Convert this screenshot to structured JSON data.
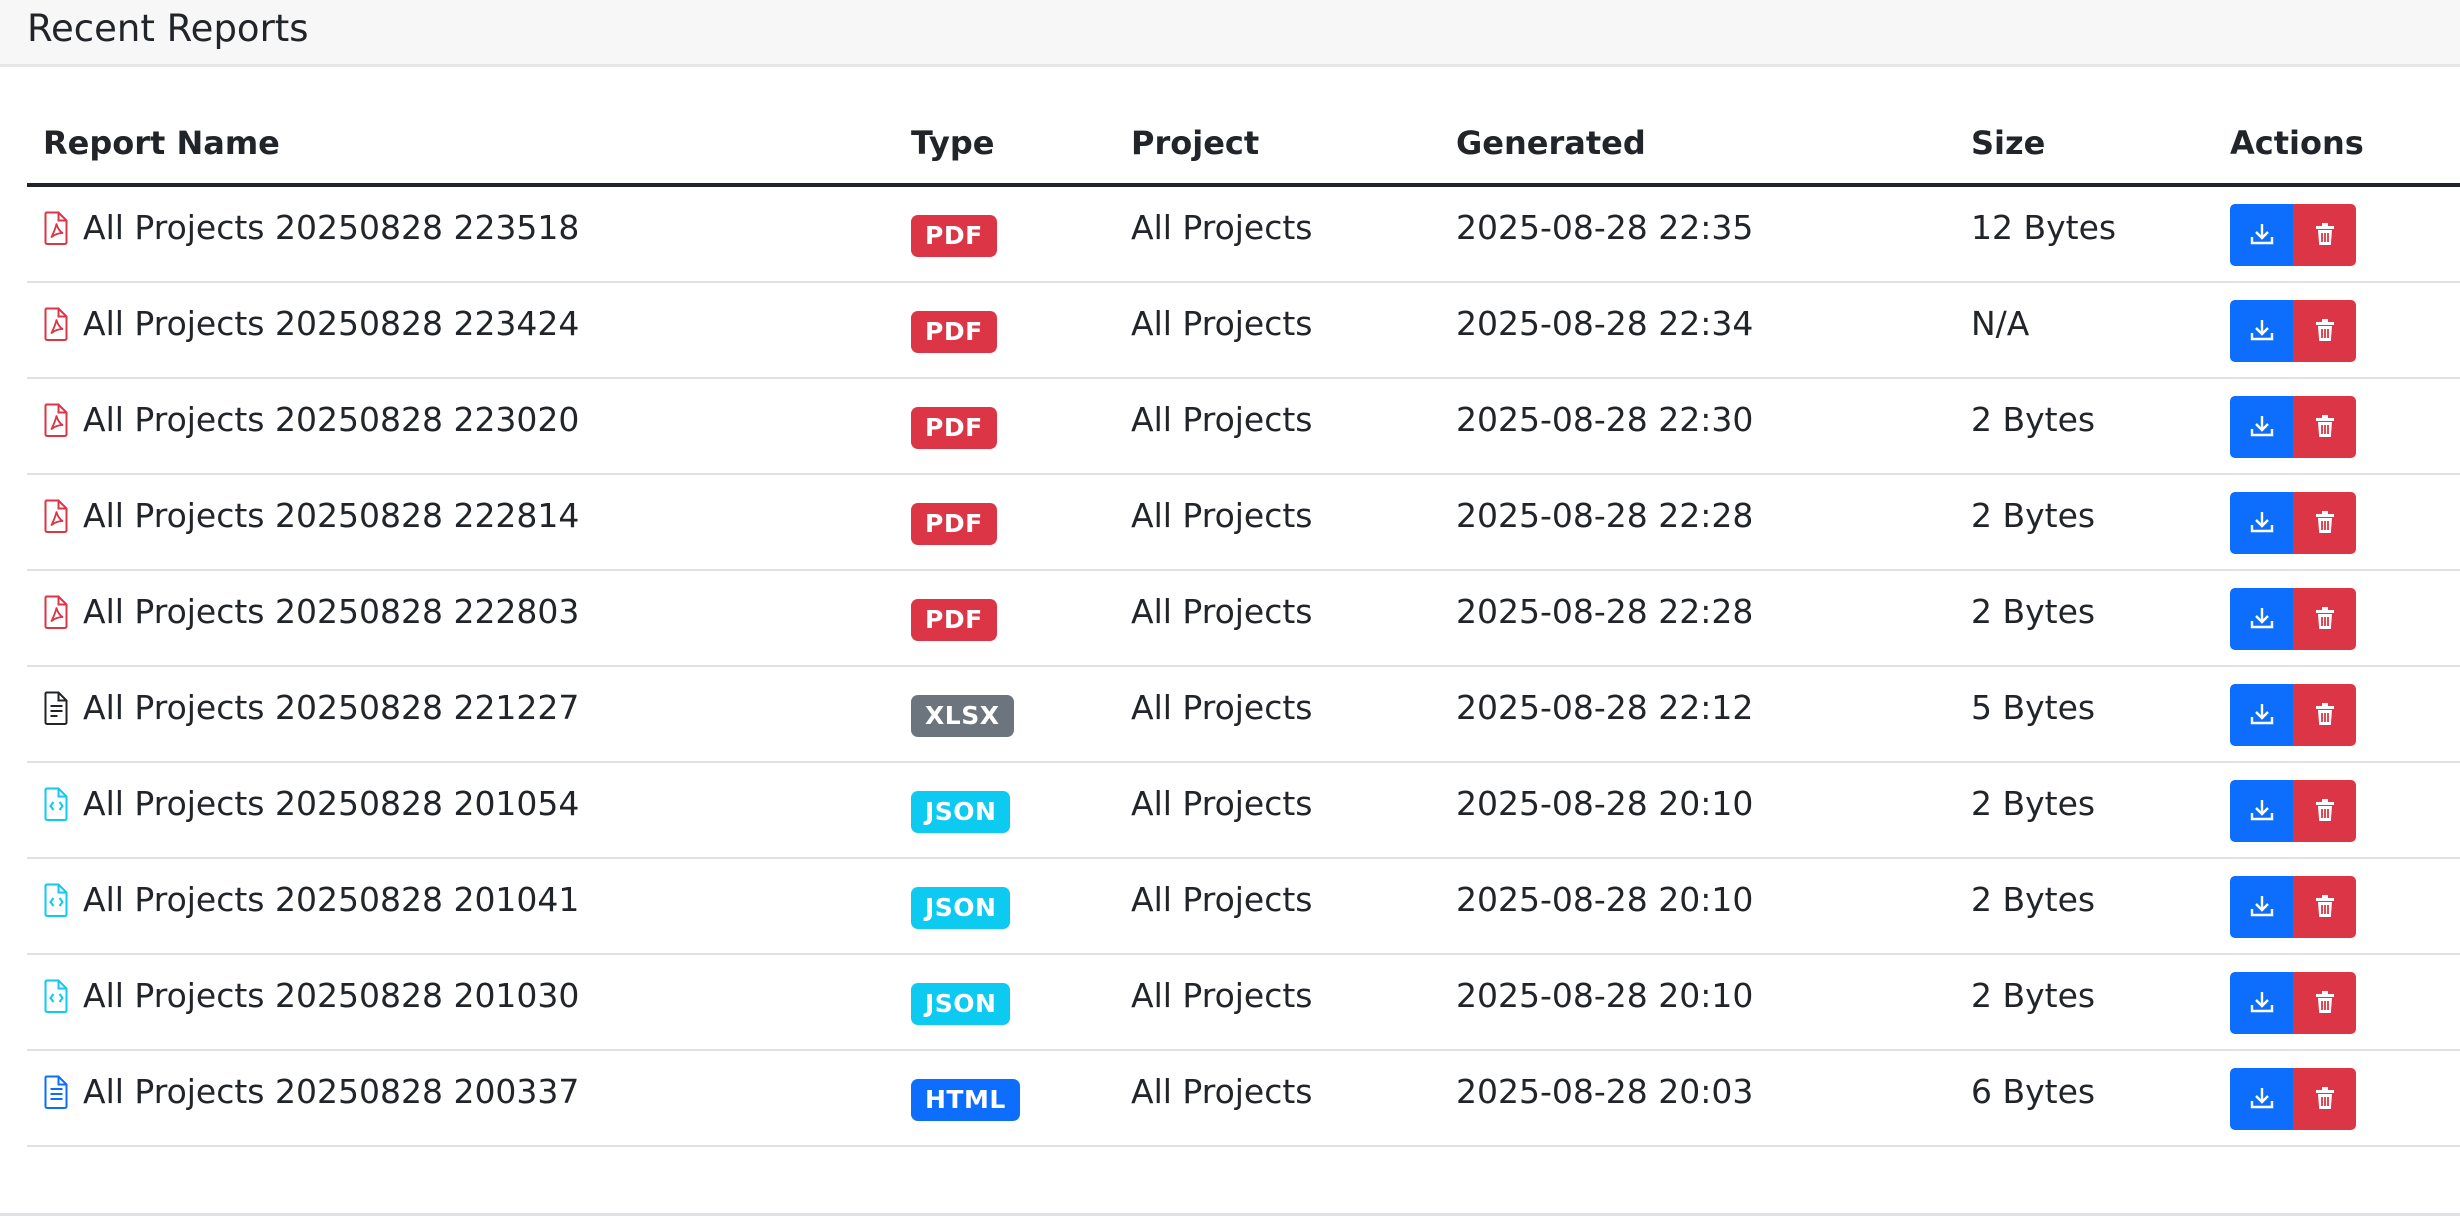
{
  "card": {
    "title": "Recent Reports"
  },
  "table": {
    "headers": {
      "name": "Report Name",
      "type": "Type",
      "project": "Project",
      "generated": "Generated",
      "size": "Size",
      "actions": "Actions"
    },
    "rows": [
      {
        "name": "All Projects 20250828 223518",
        "type": "PDF",
        "project": "All Projects",
        "generated": "2025-08-28 22:35",
        "size": "12 Bytes",
        "icon": "file-pdf-icon"
      },
      {
        "name": "All Projects 20250828 223424",
        "type": "PDF",
        "project": "All Projects",
        "generated": "2025-08-28 22:34",
        "size": "N/A",
        "icon": "file-pdf-icon"
      },
      {
        "name": "All Projects 20250828 223020",
        "type": "PDF",
        "project": "All Projects",
        "generated": "2025-08-28 22:30",
        "size": "2 Bytes",
        "icon": "file-pdf-icon"
      },
      {
        "name": "All Projects 20250828 222814",
        "type": "PDF",
        "project": "All Projects",
        "generated": "2025-08-28 22:28",
        "size": "2 Bytes",
        "icon": "file-pdf-icon"
      },
      {
        "name": "All Projects 20250828 222803",
        "type": "PDF",
        "project": "All Projects",
        "generated": "2025-08-28 22:28",
        "size": "2 Bytes",
        "icon": "file-pdf-icon"
      },
      {
        "name": "All Projects 20250828 221227",
        "type": "XLSX",
        "project": "All Projects",
        "generated": "2025-08-28 22:12",
        "size": "5 Bytes",
        "icon": "file-text-icon"
      },
      {
        "name": "All Projects 20250828 201054",
        "type": "JSON",
        "project": "All Projects",
        "generated": "2025-08-28 20:10",
        "size": "2 Bytes",
        "icon": "file-code-icon"
      },
      {
        "name": "All Projects 20250828 201041",
        "type": "JSON",
        "project": "All Projects",
        "generated": "2025-08-28 20:10",
        "size": "2 Bytes",
        "icon": "file-code-icon"
      },
      {
        "name": "All Projects 20250828 201030",
        "type": "JSON",
        "project": "All Projects",
        "generated": "2025-08-28 20:10",
        "size": "2 Bytes",
        "icon": "file-code-icon"
      },
      {
        "name": "All Projects 20250828 200337",
        "type": "HTML",
        "project": "All Projects",
        "generated": "2025-08-28 20:03",
        "size": "6 Bytes",
        "icon": "file-richtext-icon"
      }
    ]
  },
  "colors": {
    "pdf": "#dc3545",
    "xlsx": "#6c757d",
    "json": "#0dcaf0",
    "html": "#0d6efd",
    "download": "#0d6efd",
    "delete": "#dc3545",
    "file_text": "#212529"
  },
  "icons": {
    "download_button": "download-icon",
    "delete_button": "trash-icon"
  }
}
